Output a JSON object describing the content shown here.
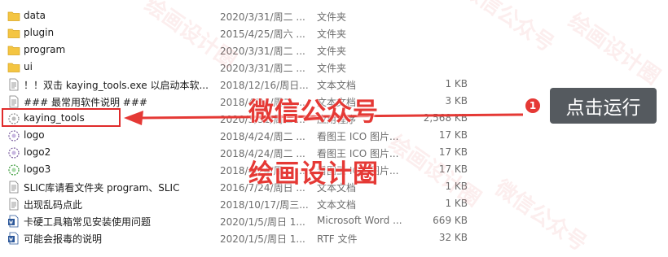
{
  "files": [
    {
      "name": "data",
      "date": "2020/3/31/周二 ...",
      "type": "文件夹",
      "size": "",
      "icon": "folder-icon"
    },
    {
      "name": "plugin",
      "date": "2015/4/25/周六 ...",
      "type": "文件夹",
      "size": "",
      "icon": "folder-icon"
    },
    {
      "name": "program",
      "date": "2020/3/31/周二 ...",
      "type": "文件夹",
      "size": "",
      "icon": "folder-icon"
    },
    {
      "name": "ui",
      "date": "2020/3/31/周二 ...",
      "type": "文件夹",
      "size": "",
      "icon": "folder-icon"
    },
    {
      "name": "！！双击 kaying_tools.exe 以启动本软...",
      "date": "2018/12/16/周日...",
      "type": "文本文档",
      "size": "1 KB",
      "icon": "text-file-icon"
    },
    {
      "name": "### 最常用软件说明 ###",
      "date": "2018/4/24/周二 ...",
      "type": "文本文档",
      "size": "3 KB",
      "icon": "text-file-icon"
    },
    {
      "name": "kaying_tools",
      "date": "2020/3/31/周二 ...",
      "type": "应用程序",
      "size": "2,568 KB",
      "icon": "app-icon"
    },
    {
      "name": "logo",
      "date": "2018/4/24/周二 ...",
      "type": "看图王 ICO 图片...",
      "size": "17 KB",
      "icon": "ico-file-icon"
    },
    {
      "name": "logo2",
      "date": "2018/4/24/周二 ...",
      "type": "看图王 ICO 图片...",
      "size": "17 KB",
      "icon": "ico-file-icon"
    },
    {
      "name": "logo3",
      "date": "2018/4/24/周二 ...",
      "type": "看图王 ICO 图片...",
      "size": "17 KB",
      "icon": "ico-file-green-icon"
    },
    {
      "name": "SLIC库请看文件夹 program、SLIC",
      "date": "2016/7/24/周日 ...",
      "type": "文本文档",
      "size": "1 KB",
      "icon": "text-file-icon"
    },
    {
      "name": "出现乱码点此",
      "date": "2018/10/17/周三...",
      "type": "文本文档",
      "size": "1 KB",
      "icon": "text-file-icon"
    },
    {
      "name": "卡硬工具箱常见安装使用问题",
      "date": "2020/1/5/周日 1...",
      "type": "Microsoft Word ...",
      "size": "669 KB",
      "icon": "word-file-icon"
    },
    {
      "name": "可能会报毒的说明",
      "date": "2020/1/5/周日 1...",
      "type": "RTF 文件",
      "size": "32 KB",
      "icon": "rtf-file-icon"
    }
  ],
  "overlay": {
    "line1": "微信公众号",
    "line2": "绘画设计圈",
    "badge": "1",
    "callout": "点击运行"
  },
  "watermarks": [
    "绘画设计圈",
    "绘画设计圈",
    "微信公众号",
    "绘画设计圈",
    "微信公众号"
  ],
  "colors": {
    "accent": "#e53935",
    "callout_bg": "#555a5f",
    "folder": "#f4c542"
  }
}
